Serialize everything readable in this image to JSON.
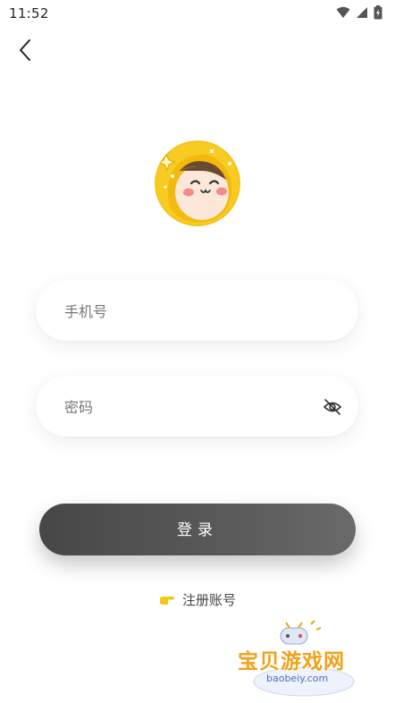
{
  "status_bar": {
    "time": "11:52",
    "icons": [
      "wifi-icon",
      "signal-icon",
      "battery-icon"
    ]
  },
  "nav": {
    "back_icon": "chevron-left-icon"
  },
  "form": {
    "phone_placeholder": "手机号",
    "phone_value": "",
    "password_placeholder": "密码",
    "password_value": "",
    "password_toggle_icon": "eye-off-icon"
  },
  "login_label": "登录",
  "register": {
    "label": "注册账号",
    "icon": "pointing-hand-icon"
  },
  "watermark": {
    "title": "宝贝游戏网",
    "url": "baobeiy.com"
  },
  "colors": {
    "button": "#4d4d4d",
    "accent": "#f5c518",
    "watermark": "#f0a21a"
  }
}
